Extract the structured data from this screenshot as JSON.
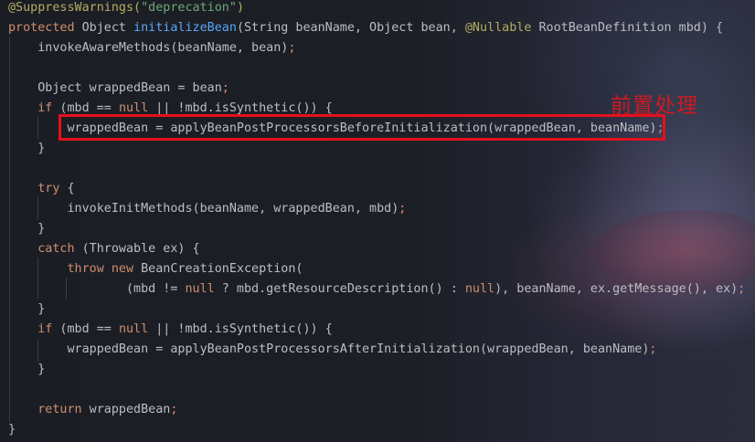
{
  "code": {
    "lines": [
      [
        {
          "t": "@SuppressWarnings(",
          "c": "ann"
        },
        {
          "t": "\"deprecation\"",
          "c": "str"
        },
        {
          "t": ")",
          "c": "ann"
        }
      ],
      [
        {
          "t": "protected ",
          "c": "kw"
        },
        {
          "t": "Object "
        },
        {
          "t": "initializeBean",
          "c": "fn"
        },
        {
          "t": "(String beanName, Object bean, "
        },
        {
          "t": "@Nullable",
          "c": "ann"
        },
        {
          "t": " RootBeanDefinition mbd) {"
        }
      ],
      [
        {
          "t": "    invokeAwareMethods(beanName, bean)"
        },
        {
          "t": ";",
          "c": "kw"
        }
      ],
      [],
      [
        {
          "t": "    Object wrappedBean = bean"
        },
        {
          "t": ";",
          "c": "kw"
        }
      ],
      [
        {
          "t": "    "
        },
        {
          "t": "if",
          "c": "kw"
        },
        {
          "t": " (mbd == "
        },
        {
          "t": "null",
          "c": "kw"
        },
        {
          "t": " || !mbd.isSynthetic()) {"
        }
      ],
      [
        {
          "t": "        wrappedBean = applyBeanPostProcessorsBeforeInitialization(wrappedBean, beanName)"
        },
        {
          "t": ";",
          "c": "kw"
        }
      ],
      [
        {
          "t": "    }"
        }
      ],
      [],
      [
        {
          "t": "    "
        },
        {
          "t": "try",
          "c": "kw"
        },
        {
          "t": " {"
        }
      ],
      [
        {
          "t": "        invokeInitMethods(beanName, wrappedBean, mbd)"
        },
        {
          "t": ";",
          "c": "kw"
        }
      ],
      [
        {
          "t": "    }"
        }
      ],
      [
        {
          "t": "    "
        },
        {
          "t": "catch",
          "c": "kw"
        },
        {
          "t": " (Throwable ex) {"
        }
      ],
      [
        {
          "t": "        "
        },
        {
          "t": "throw new",
          "c": "kw"
        },
        {
          "t": " BeanCreationException("
        }
      ],
      [
        {
          "t": "                (mbd != "
        },
        {
          "t": "null",
          "c": "kw"
        },
        {
          "t": " ? mbd.getResourceDescription() : "
        },
        {
          "t": "null",
          "c": "kw"
        },
        {
          "t": "), beanName, ex.getMessage(), ex)"
        },
        {
          "t": ";",
          "c": "kw"
        }
      ],
      [
        {
          "t": "    }"
        }
      ],
      [
        {
          "t": "    "
        },
        {
          "t": "if",
          "c": "kw"
        },
        {
          "t": " (mbd == "
        },
        {
          "t": "null",
          "c": "kw"
        },
        {
          "t": " || !mbd.isSynthetic()) {"
        }
      ],
      [
        {
          "t": "        wrappedBean = applyBeanPostProcessorsAfterInitialization(wrappedBean, beanName)"
        },
        {
          "t": ";",
          "c": "kw"
        }
      ],
      [
        {
          "t": "    }"
        }
      ],
      [],
      [
        {
          "t": "    "
        },
        {
          "t": "return",
          "c": "kw"
        },
        {
          "t": " wrappedBean"
        },
        {
          "t": ";",
          "c": "kw"
        }
      ],
      [
        {
          "t": "}"
        }
      ]
    ]
  },
  "annotation": {
    "label": "前置处理",
    "color": "#e5101d"
  },
  "colors": {
    "keyword": "#cf8e6d",
    "annotation": "#b3ae60",
    "string": "#6aab73",
    "method": "#56a8f5",
    "text": "#bcbec4"
  }
}
